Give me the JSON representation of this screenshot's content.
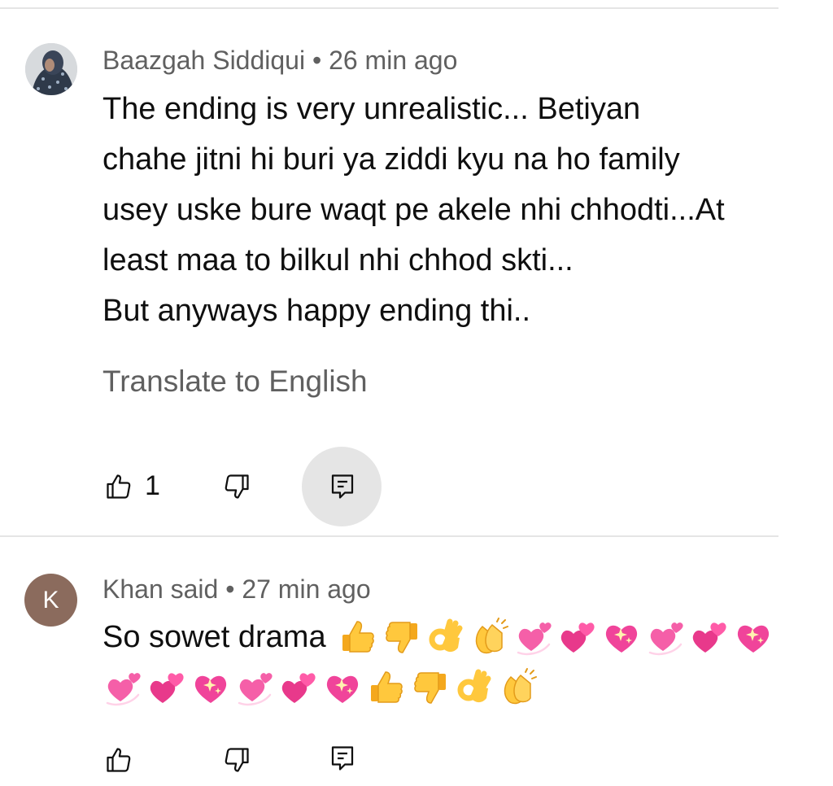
{
  "comments": [
    {
      "author": "Baazgah Siddiqui",
      "time": "26 min ago",
      "lines": [
        "The ending is very unrealistic... Betiyan",
        "chahe jitni hi buri ya ziddi kyu na ho family",
        "usey uske bure waqt pe akele nhi chhodti...At",
        "least maa to bilkul nhi chhod skti...",
        "But anyways happy ending thi.."
      ],
      "translate_label": "Translate to English",
      "like_count": "1"
    },
    {
      "author": "Khan said",
      "time": "27 min ago",
      "avatar_letter": "K",
      "avatar_color": "#8b6b5d",
      "text": "So sowet drama",
      "emoji_line1": [
        "thumbs-up",
        "thumbs-down",
        "ok-hand",
        "clapping-hands",
        "revolving-hearts",
        "two-hearts",
        "sparkling-heart",
        "revolving-hearts",
        "two-hearts",
        "sparkling-heart"
      ],
      "emoji_line2": [
        "revolving-hearts",
        "two-hearts",
        "sparkling-heart",
        "revolving-hearts",
        "two-hearts",
        "sparkling-heart",
        "thumbs-up",
        "thumbs-down",
        "ok-hand",
        "clapping-hands"
      ]
    }
  ],
  "separator": "•",
  "colors": {
    "meta": "#606060",
    "divider": "#e5e5e5",
    "reply_highlight": "#e5e5e5"
  }
}
